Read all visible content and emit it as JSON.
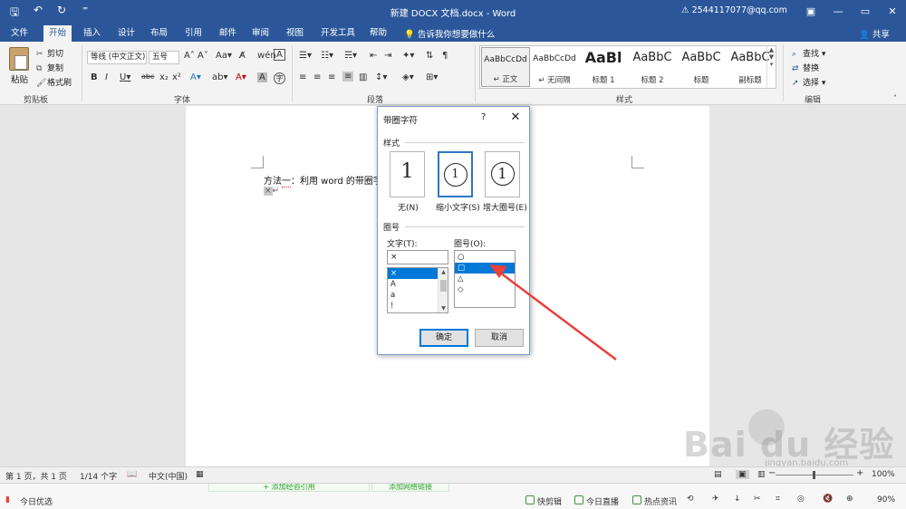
{
  "window": {
    "title": "新建 DOCX 文档.docx  -  Word",
    "account": "2544117077@qq.com",
    "warning_icon": "warning-icon",
    "min_glyph": "—",
    "restore_glyph": "▭",
    "close_glyph": "✕"
  },
  "qat": {
    "save": "🖫",
    "undo": "↶",
    "redo": "↻",
    "more": "⁼"
  },
  "tabs": [
    "文件",
    "开始",
    "插入",
    "设计",
    "布局",
    "引用",
    "邮件",
    "审阅",
    "视图",
    "开发工具",
    "帮助"
  ],
  "tell_me": "告诉我你想要做什么",
  "share": "共享",
  "ribbon": {
    "clipboard": {
      "paste": "粘贴",
      "cut": "剪切",
      "copy": "复制",
      "format_painter": "格式刷",
      "label": "剪贴板"
    },
    "font": {
      "name": "等线 (中文正文)",
      "size": "五号",
      "label": "字体"
    },
    "paragraph": {
      "label": "段落"
    },
    "styles": {
      "label": "样式",
      "items": [
        {
          "preview": "AaBbCcDd",
          "name": "↵ 正文"
        },
        {
          "preview": "AaBbCcDd",
          "name": "↵ 无间隔"
        },
        {
          "preview": "AaBl",
          "name": "标题 1"
        },
        {
          "preview": "AaBbC",
          "name": "标题 2"
        },
        {
          "preview": "AaBbC",
          "name": "标题"
        },
        {
          "preview": "AaBbC",
          "name": "副标题"
        }
      ]
    },
    "editing": {
      "find": "查找",
      "replace": "替换",
      "select": "选择",
      "label": "编辑"
    }
  },
  "document": {
    "line1_prefix": "方法",
    "line1_squiggle": "一",
    "line1_rest": "：利用 word 的带圈字",
    "line2_char": "×",
    "line2_mark": "↵"
  },
  "dialog": {
    "title": "带圈字符",
    "help": "?",
    "close": "✕",
    "style_section": "样式",
    "style_options": [
      {
        "glyph": "1",
        "label": "无(N)"
      },
      {
        "glyph": "1",
        "label": "缩小文字(S)"
      },
      {
        "glyph": "1",
        "label": "增大圈号(E)"
      }
    ],
    "enclosure_section": "圈号",
    "text_label": "文字(T):",
    "text_value": "×",
    "text_list": [
      "×",
      "A",
      "a",
      "!"
    ],
    "encl_label": "圈号(O):",
    "encl_list": [
      "○",
      "□",
      "△",
      "◇"
    ],
    "ok": "确定",
    "cancel": "取消"
  },
  "statusbar": {
    "page": "第 1 页，共 1 页",
    "words": "1/14 个字",
    "language": "中文(中国)",
    "zoom": "100%",
    "zoom_minus": "−",
    "zoom_plus": "+"
  },
  "taskbar": {
    "news": "今日优选",
    "add_ref": "+ 添加经验引用",
    "add_tip": "添加网络链接",
    "quick_clip": "快剪辑",
    "live": "今日直播",
    "hot_news": "热点资讯",
    "download_icon": "↓",
    "volume": "90%"
  },
  "watermark": {
    "text": "Bai du 经验",
    "sub": "jingyan.baidu.com"
  },
  "colors": {
    "brand": "#2b579a",
    "selection": "#0078d7",
    "arrow": "#e8413a"
  }
}
